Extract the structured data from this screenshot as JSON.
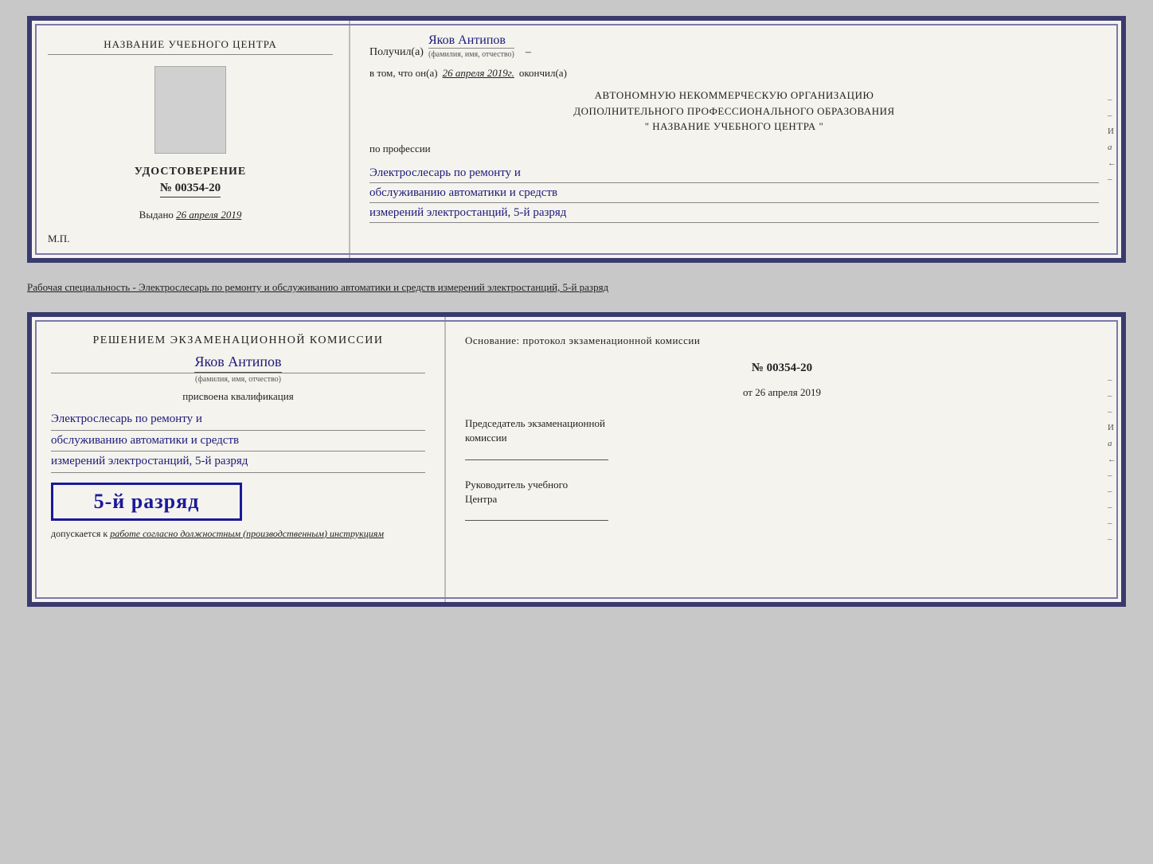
{
  "top_diploma": {
    "left": {
      "org_name": "НАЗВАНИЕ УЧЕБНОГО ЦЕНТРА",
      "udost_title": "УДОСТОВЕРЕНИЕ",
      "udost_number": "№ 00354-20",
      "vydano_label": "Выдано",
      "vydano_date": "26 апреля 2019",
      "mp": "М.П."
    },
    "right": {
      "poluchil_label": "Получил(а)",
      "fio_value": "Яков Антипов",
      "fio_sub": "(фамилия, имя, отчество)",
      "vtom_label": "в том, что он(а)",
      "vtom_date": "26 апреля 2019г.",
      "okonchil_label": "окончил(а)",
      "org_line1": "АВТОНОМНУЮ НЕКОММЕРЧЕСКУЮ ОРГАНИЗАЦИЮ",
      "org_line2": "ДОПОЛНИТЕЛЬНОГО ПРОФЕССИОНАЛЬНОГО ОБРАЗОВАНИЯ",
      "org_line3": "\" НАЗВАНИЕ УЧЕБНОГО ЦЕНТРА \"",
      "po_professii": "по профессии",
      "profession_line1": "Электрослесарь по ремонту и",
      "profession_line2": "обслуживанию автоматики и средств",
      "profession_line3": "измерений электростанций, 5-й разряд"
    }
  },
  "separator": {
    "text": "Рабочая специальность - Электрослесарь по ремонту и обслуживанию автоматики и средств измерений электростанций, 5-й разряд"
  },
  "bottom_diploma": {
    "left": {
      "resheniem_label": "Решением экзаменационной комиссии",
      "fio_value": "Яков Антипов",
      "fio_sub": "(фамилия, имя, отчество)",
      "prisvoena_label": "присвоена квалификация",
      "kval_line1": "Электрослесарь по ремонту и",
      "kval_line2": "обслуживанию автоматики и средств",
      "kval_line3": "измерений электростанций, 5-й разряд",
      "razryad_stamp": "5-й разряд",
      "dopusk_label": "допускается к",
      "dopusk_text": "работе согласно должностным (производственным) инструкциям"
    },
    "right": {
      "osnovanie_label": "Основание: протокол экзаменационной комиссии",
      "protocol_number": "№ 00354-20",
      "ot_label": "от",
      "ot_date": "26 апреля 2019",
      "predsedatel_label": "Председатель экзаменационной",
      "predsedatel_label2": "комиссии",
      "rukovoditel_label": "Руководитель учебного",
      "rukovoditel_label2": "Центра"
    },
    "side_marks": [
      "–",
      "–",
      "–",
      "И",
      "а",
      "←",
      "–",
      "–",
      "–",
      "–",
      "–"
    ]
  }
}
